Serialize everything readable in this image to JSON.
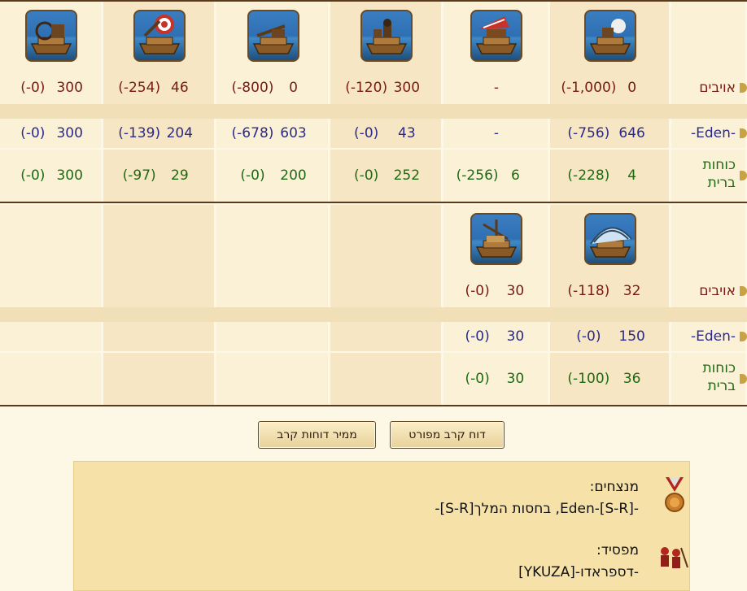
{
  "battle1": {
    "units": [
      {
        "name": "ship-flame-thrower-icon"
      },
      {
        "name": "ship-ram-icon"
      },
      {
        "name": "ship-mortar-icon"
      },
      {
        "name": "ship-ballista-icon"
      },
      {
        "name": "ship-catapult-icon"
      },
      {
        "name": "ship-steam-ram-icon"
      }
    ],
    "rows": [
      {
        "label": "אויבים",
        "cls": "red",
        "cells": [
          [
            "0",
            "(-1,000)"
          ],
          [
            "-",
            ""
          ],
          [
            "300",
            "(-120)"
          ],
          [
            "0",
            "(-800)"
          ],
          [
            "46",
            "(-254)"
          ],
          [
            "300",
            "(-0)"
          ]
        ]
      },
      {
        "label": "-Eden-",
        "cls": "blue",
        "cells": [
          [
            "646",
            "(-756)"
          ],
          [
            "-",
            ""
          ],
          [
            "43",
            "(-0)"
          ],
          [
            "603",
            "(-678)"
          ],
          [
            "204",
            "(-139)"
          ],
          [
            "300",
            "(-0)"
          ]
        ]
      },
      {
        "label": "כוחות\nברית",
        "cls": "green",
        "cells": [
          [
            "4",
            "(-228)"
          ],
          [
            "6",
            "(-256)"
          ],
          [
            "252",
            "(-0)"
          ],
          [
            "200",
            "(-0)"
          ],
          [
            "29",
            "(-97)"
          ],
          [
            "300",
            "(-0)"
          ]
        ]
      }
    ]
  },
  "battle2": {
    "units": [
      {
        "name": "ship-paddle-wheel-icon"
      },
      {
        "name": "ship-diving-boat-icon"
      }
    ],
    "rows": [
      {
        "label": "אויבים",
        "cls": "red",
        "cells": [
          [
            "32",
            "(-118)"
          ],
          [
            "30",
            "(-0)"
          ]
        ]
      },
      {
        "label": "-Eden-",
        "cls": "blue",
        "cells": [
          [
            "150",
            "(-0)"
          ],
          [
            "30",
            "(-0)"
          ]
        ]
      },
      {
        "label": "כוחות\nברית",
        "cls": "green",
        "cells": [
          [
            "36",
            "(-100)"
          ],
          [
            "30",
            "(-0)"
          ]
        ]
      }
    ]
  },
  "buttons": {
    "detailed": "דוח קרב מפורט",
    "sorter": "ממיר דוחות קרב"
  },
  "result": {
    "winners_title": "מנצחים:",
    "winners_text": "-Eden-[S-R], בחסות המלך[S-R]-",
    "loser_title": "מפסיד:",
    "loser_text": "-דספראדו-[YKUZA]"
  },
  "colors": {
    "enemy": "#7a1a14",
    "ally_player": "#2b2a8a",
    "allies": "#1d6a12",
    "frame": "#5a3a1a"
  }
}
